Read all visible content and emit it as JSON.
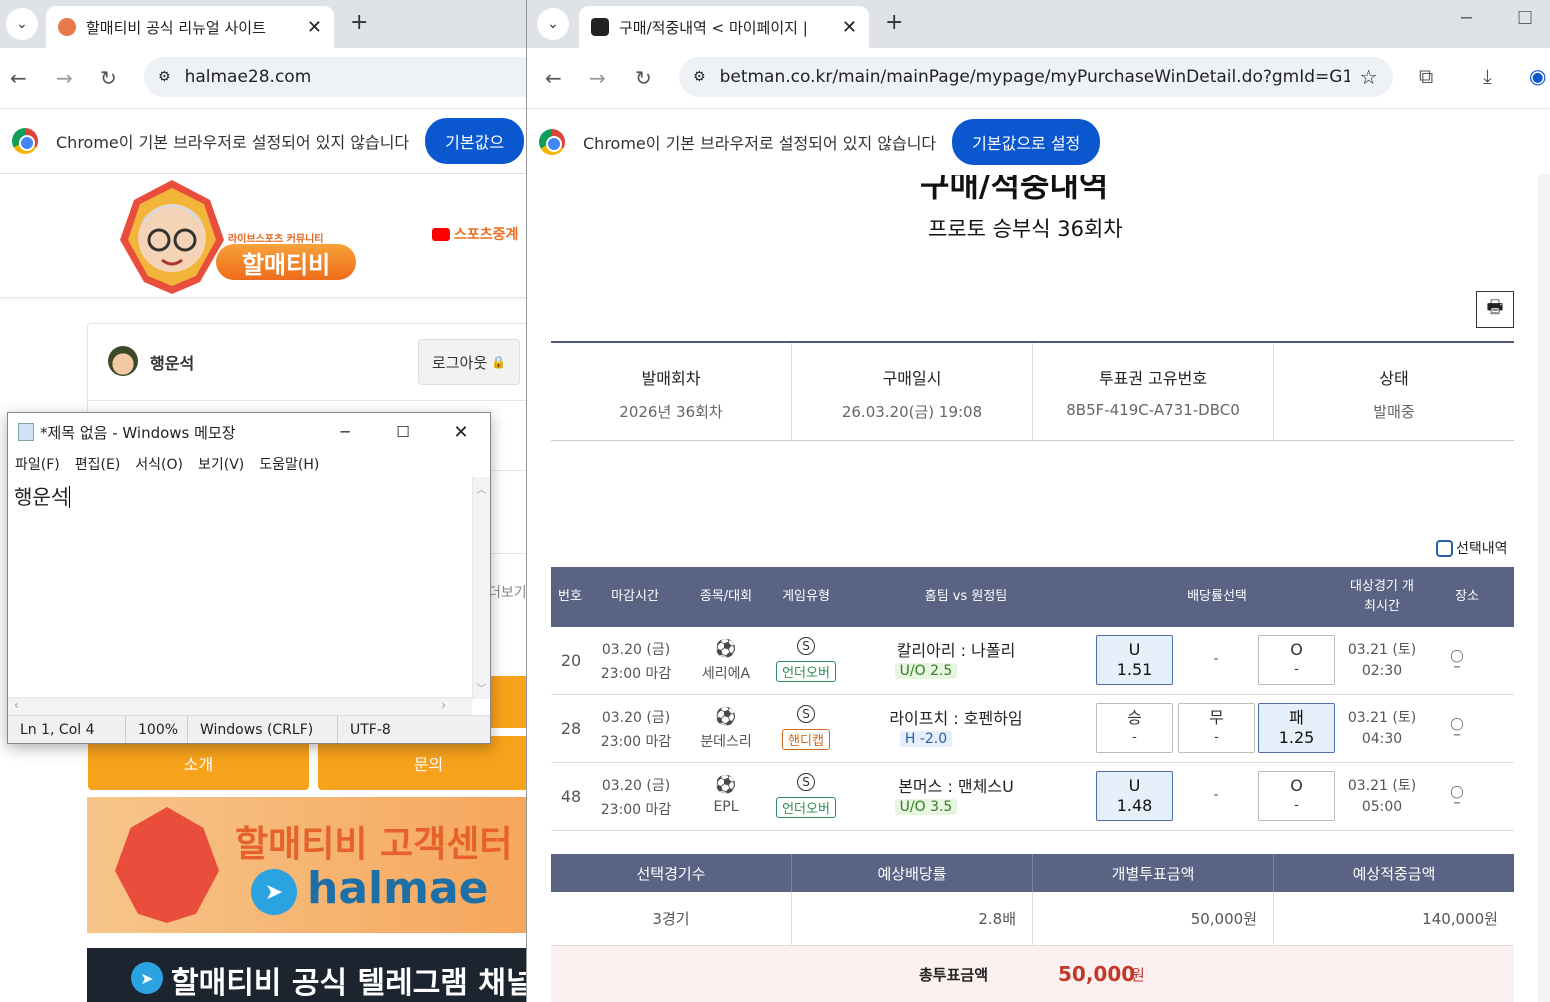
{
  "left_browser": {
    "tab_title": "할매티비 공식 리뉴얼 사이트",
    "url": "halmae28.com",
    "infobar_text": "Chrome이 기본 브라우저로 설정되어 있지 않습니다",
    "infobar_button": "기본값으",
    "site": {
      "logo_sub": "라이브스포츠 커뮤니티",
      "logo_main": "할매티비",
      "nav_item": "스포츠중계",
      "username": "행운석",
      "logout_label": "로그아웃",
      "more_label": "더보기",
      "btn_intro": "소개",
      "btn_inquiry": "문의",
      "banner1_title": "할매티비 고객센터",
      "banner1_handle": "halmae",
      "banner2_title": "할매티비 공식 텔레그램 채널"
    }
  },
  "notepad": {
    "title": "*제목 없음 - Windows 메모장",
    "menu": [
      "파일(F)",
      "편집(E)",
      "서식(O)",
      "보기(V)",
      "도움말(H)"
    ],
    "content": "행운석",
    "status": [
      "Ln 1, Col 4",
      "100%",
      "Windows (CRLF)",
      "UTF-8"
    ]
  },
  "right_browser": {
    "tab_title": "구매/적중내역 < 마이페이지 |",
    "url": "betman.co.kr/main/mainPage/mypage/myPurchaseWinDetail.do?gmId=G10...",
    "infobar_text": "Chrome이 기본 브라우저로 설정되어 있지 않습니다",
    "infobar_button": "기본값으로 설정",
    "page": {
      "heading": "구매/적중내역",
      "subheading": "프로토 승부식 36회차",
      "summary": [
        {
          "label": "발매회차",
          "value": "2026년 36회차"
        },
        {
          "label": "구매일시",
          "value": "26.03.20(금) 19:08"
        },
        {
          "label": "투표권 고유번호",
          "value": "8B5F-419C-A731-DBC0"
        },
        {
          "label": "상태",
          "value": "발매중"
        }
      ],
      "select_label": "선택내역",
      "columns": [
        "번호",
        "마감시간",
        "종목/대회",
        "게임유형",
        "홈팀 vs 원정팀",
        "배당률선택",
        "대상경기 개최시간",
        "장소"
      ],
      "rows": [
        {
          "no": "20",
          "deadline_date": "03.20 (금)",
          "deadline_time": "23:00 마감",
          "league": "세리에A",
          "type_icon": "S",
          "type": "언더오버",
          "match": "칼리아리 : 나폴리",
          "handicap": "U/O 2.5",
          "odd1_label": "U",
          "odd1_value": "1.51",
          "mid": "-",
          "odd3_label": "O",
          "odd3_value": "-",
          "game_date": "03.21 (토)",
          "game_time": "02:30"
        },
        {
          "no": "28",
          "deadline_date": "03.20 (금)",
          "deadline_time": "23:00 마감",
          "league": "분데스리",
          "type_icon": "S",
          "type": "핸디캡",
          "match": "라이프치 : 호펜하임",
          "handicap": "H -2.0",
          "odd1_label": "승",
          "odd1_value": "-",
          "mid_label": "무",
          "mid_value": "-",
          "odd3_label": "패",
          "odd3_value": "1.25",
          "game_date": "03.21 (토)",
          "game_time": "04:30"
        },
        {
          "no": "48",
          "deadline_date": "03.20 (금)",
          "deadline_time": "23:00 마감",
          "league": "EPL",
          "type_icon": "S",
          "type": "언더오버",
          "match": "본머스 : 맨체스U",
          "handicap": "U/O 3.5",
          "odd1_label": "U",
          "odd1_value": "1.48",
          "mid": "-",
          "odd3_label": "O",
          "odd3_value": "-",
          "game_date": "03.21 (토)",
          "game_time": "05:00"
        }
      ],
      "totals_header": [
        "선택경기수",
        "예상배당률",
        "개별투표금액",
        "예상적중금액"
      ],
      "totals_values": [
        "3경기",
        "2.8배",
        "50,000원",
        "140,000원"
      ],
      "total_label": "총투표금액",
      "total_amount": "50,000",
      "total_unit": "원"
    }
  },
  "colors": {
    "accent_blue": "#0b57d0",
    "orange": "#f7a21b",
    "table_header": "#5a6384",
    "total_red": "#c0392b"
  }
}
